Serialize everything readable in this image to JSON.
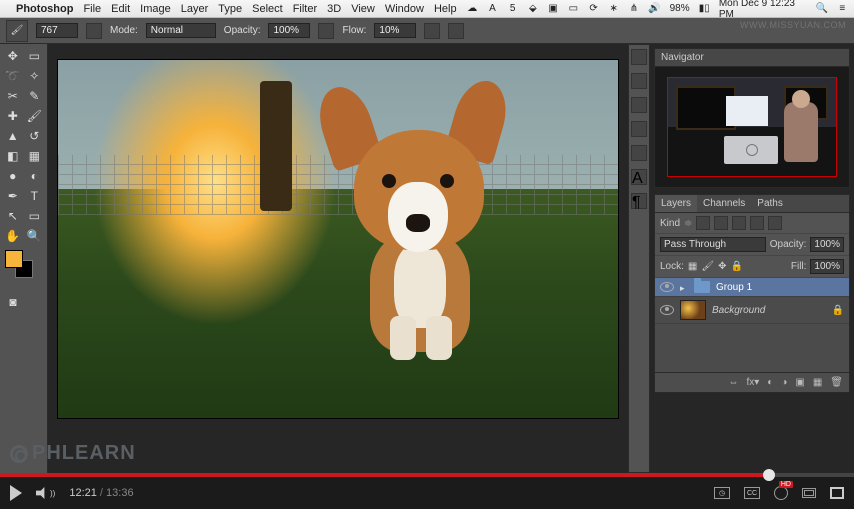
{
  "mac_menu": {
    "app": "Photoshop",
    "items": [
      "File",
      "Edit",
      "Image",
      "Layer",
      "Type",
      "Select",
      "Filter",
      "3D",
      "View",
      "Window",
      "Help"
    ],
    "status_pct": "98%",
    "clock": "Mon Dec 9  12:23 PM"
  },
  "options_bar": {
    "brush_size": "767",
    "mode_label": "Mode:",
    "mode_value": "Normal",
    "opacity_label": "Opacity:",
    "opacity_value": "100%",
    "flow_label": "Flow:",
    "flow_value": "10%"
  },
  "swatch": {
    "fg": "#f6b43c",
    "bg": "#000000"
  },
  "navigator": {
    "title": "Navigator"
  },
  "layers_panel": {
    "tabs": [
      "Layers",
      "Channels",
      "Paths"
    ],
    "kind_label": "Kind",
    "blend_mode": "Pass Through",
    "opacity_label": "Opacity:",
    "opacity_value": "100%",
    "lock_label": "Lock:",
    "fill_label": "Fill:",
    "fill_value": "100%",
    "layers": [
      {
        "name": "Group 1",
        "type": "group",
        "selected": true
      },
      {
        "name": "Background",
        "type": "image",
        "locked": true
      }
    ],
    "footer_icons": [
      "fx",
      "mask",
      "adj",
      "group",
      "new",
      "trash"
    ]
  },
  "watermark": "PHLEARN",
  "url_watermark": "WWW.MISSYUAN.COM",
  "player": {
    "current": "12:21",
    "total": "13:36",
    "progress_pct": 90,
    "cc": "CC",
    "hd": "HD"
  }
}
